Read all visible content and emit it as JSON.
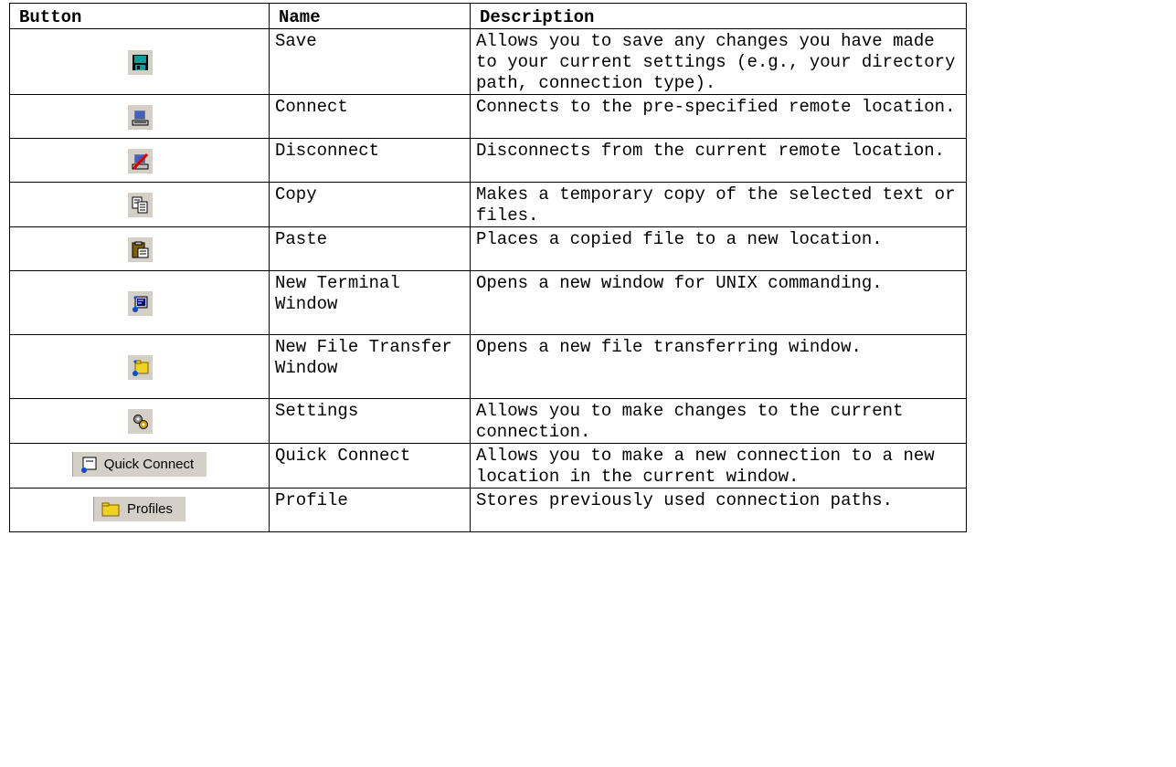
{
  "headers": {
    "button": "Button",
    "name": "Name",
    "description": "Description"
  },
  "rows": [
    {
      "icon": "floppy-disk-icon",
      "name": "Save",
      "desc": "Allows you to save any changes you have made to your current settings (e.g., your directory path, connection type)."
    },
    {
      "icon": "computer-connect-icon",
      "name": "Connect",
      "desc": "Connects to the pre-specified remote location."
    },
    {
      "icon": "computer-disconnect-icon",
      "name": "Disconnect",
      "desc": "Disconnects from the current remote location."
    },
    {
      "icon": "copy-icon",
      "name": "Copy",
      "desc": "Makes a temporary copy of the selected text or files."
    },
    {
      "icon": "paste-clipboard-icon",
      "name": "Paste",
      "desc": "Places a copied file to a new location."
    },
    {
      "icon": "terminal-window-icon",
      "name": "New Terminal Window",
      "desc": "Opens a new window for UNIX commanding."
    },
    {
      "icon": "file-transfer-window-icon",
      "name": "New File Transfer Window",
      "desc": "Opens a new file transferring window."
    },
    {
      "icon": "settings-gears-icon",
      "name": "Settings",
      "desc": "Allows you to make changes to the current connection."
    },
    {
      "icon": "quick-connect-icon",
      "name": "Quick Connect",
      "desc": "Allows you to make a new connection to a new location in the current window.",
      "button_label": "Quick Connect"
    },
    {
      "icon": "folder-icon",
      "name": "Profile",
      "desc": "Stores previously used connection paths.",
      "button_label": "Profiles"
    }
  ]
}
